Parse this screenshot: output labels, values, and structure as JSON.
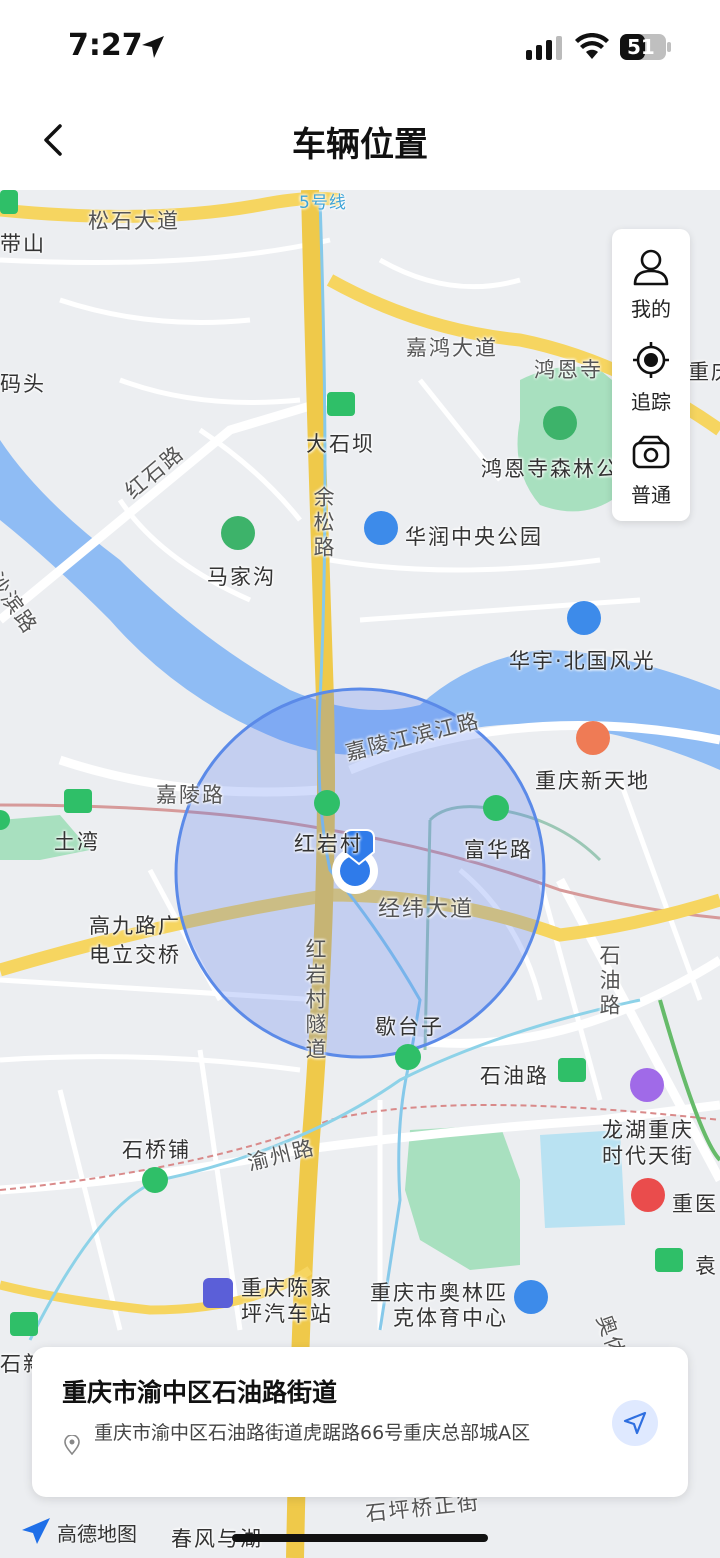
{
  "status": {
    "time": "7:27",
    "battery": "51"
  },
  "header": {
    "title": "车辆位置"
  },
  "side_panel": [
    {
      "label": "我的",
      "icon": "person-icon"
    },
    {
      "label": "追踪",
      "icon": "crosshair-icon"
    },
    {
      "label": "普通",
      "icon": "camera-icon"
    }
  ],
  "map": {
    "labels": {
      "line5": "5号线",
      "songshi": "松石大道",
      "daishan": "带山",
      "matou": "码头",
      "jiahong": "嘉鸿大道",
      "hongensi": "鸿恩寺",
      "chongqing_r": "重庆",
      "dashiba": "大石坝",
      "hongenpark": "鸿恩寺森林公",
      "hongshi": "红石路",
      "yusong": "余松路",
      "huarun": "华润中央公园",
      "majiagou": "马家沟",
      "shabin": "沙滨路",
      "huayu": "华宇·北国风光",
      "jialingjiang": "嘉陵江滨江路",
      "xintiandi": "重庆新天地",
      "jialinglu": "嘉陵路",
      "tuwan": "土湾",
      "hongyancun_station": "红岩村",
      "fuhua": "富华路",
      "jingwei": "经纬大道",
      "gaojiu1": "高九路广",
      "gaojiu2": "电立交桥",
      "hongyan_tunnel": "红岩村隧道",
      "shiyou_road_v": "石油路",
      "getaizi": "歇台子",
      "shiyoulu": "石油路",
      "longhu1": "龙湖重庆",
      "longhu2": "时代天街",
      "shiqiaopu": "石桥铺",
      "yuzhou": "渝州路",
      "chongyi": "重医",
      "yuan": "袁",
      "chenjiaping1": "重庆陈家",
      "chenjiaping2": "坪汽车站",
      "olympic1": "重庆市奥林匹",
      "olympic2": "克体育中心",
      "shixin": "石新",
      "aoti": "奥体",
      "shipingqiao": "石坪桥正街",
      "chunfeng": "春风与湖"
    }
  },
  "location_card": {
    "title": "重庆市渝中区石油路街道",
    "address": "重庆市渝中区石油路街道虎踞路66号重庆总部城A区"
  },
  "logo": {
    "text": "高德地图"
  }
}
